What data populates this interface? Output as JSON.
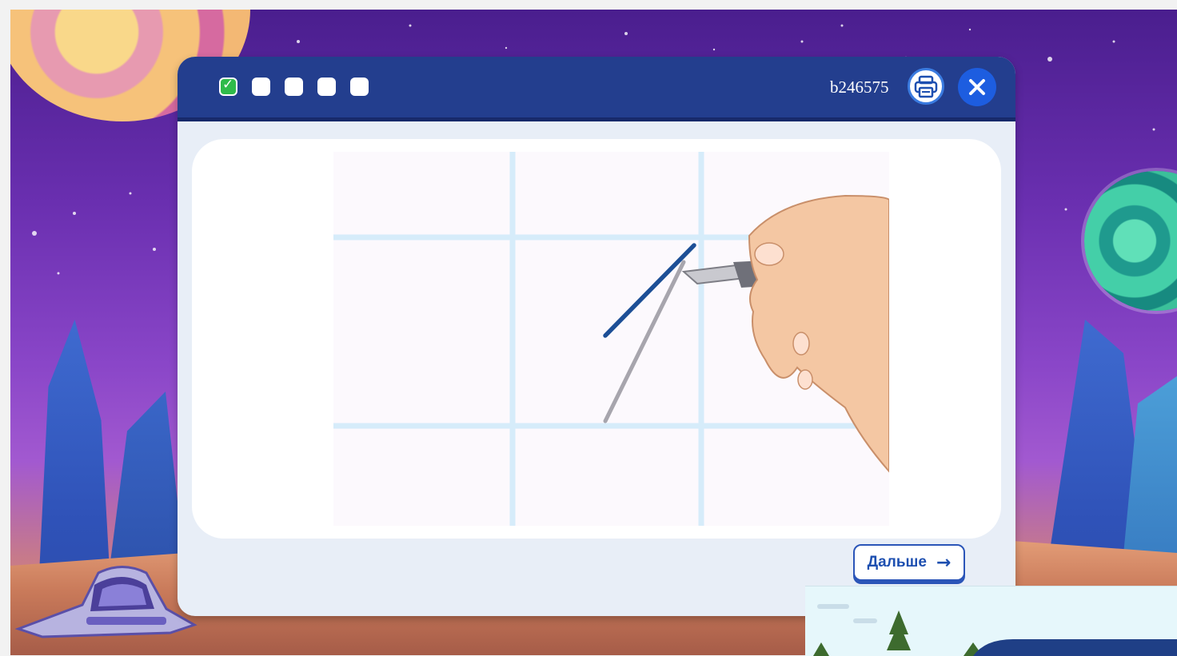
{
  "header": {
    "task_id": "b246575",
    "steps": [
      {
        "state": "done"
      },
      {
        "state": "pending"
      },
      {
        "state": "pending"
      },
      {
        "state": "pending"
      },
      {
        "state": "pending"
      }
    ],
    "print_icon": "printer-icon",
    "close_icon": "close-icon"
  },
  "footer": {
    "next_label": "Дальше",
    "next_icon": "arrow-right-icon"
  },
  "colors": {
    "titlebar": "#233e8e",
    "accent": "#1d5de0",
    "check": "#2fbb4a"
  }
}
